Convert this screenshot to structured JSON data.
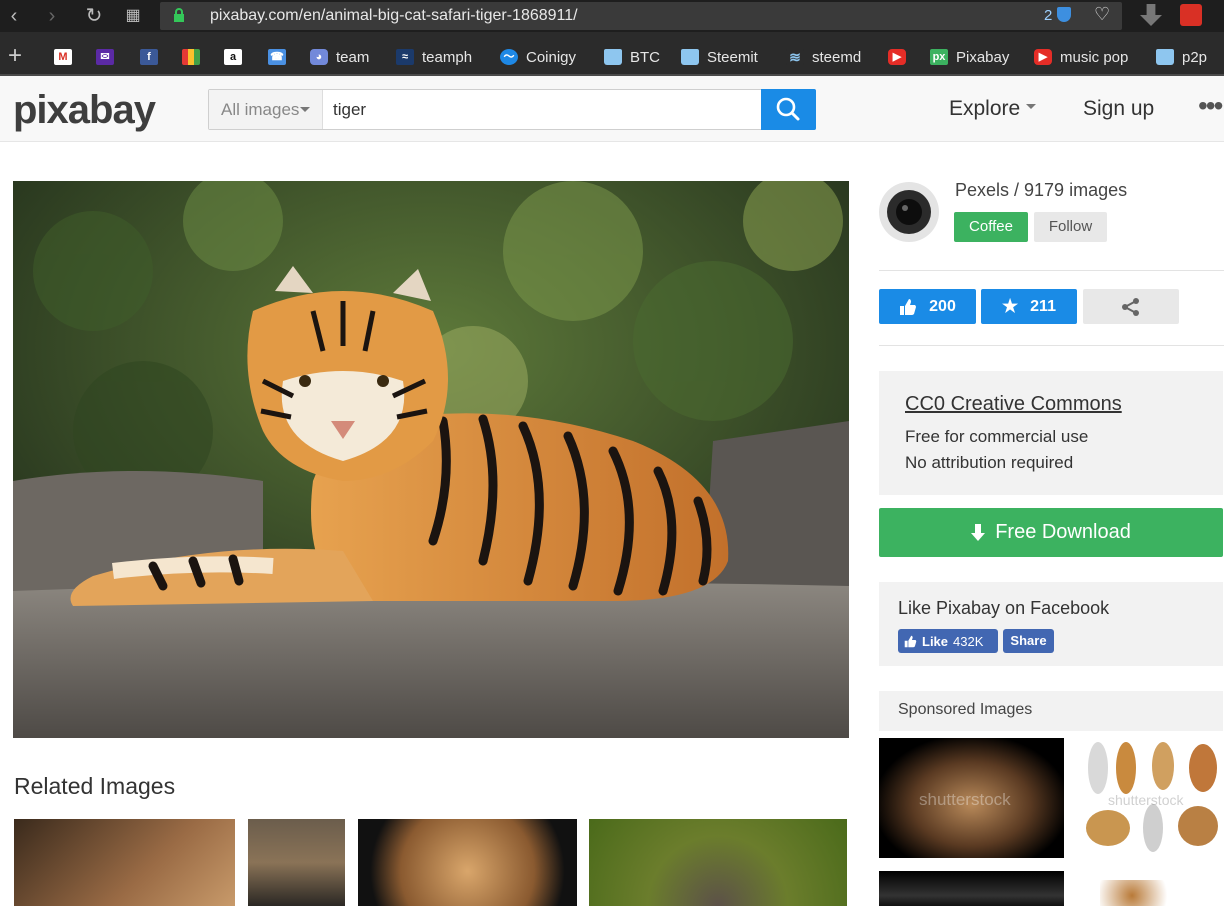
{
  "browser": {
    "url": "pixabay.com/en/animal-big-cat-safari-tiger-1868911/",
    "badge_count": "2",
    "bookmarks": [
      {
        "label": "",
        "icon": "gmail-icon"
      },
      {
        "label": "",
        "icon": "yahoo-mail-icon"
      },
      {
        "label": "",
        "icon": "facebook-icon"
      },
      {
        "label": "",
        "icon": "shopping-icon"
      },
      {
        "label": "",
        "icon": "amazon-icon"
      },
      {
        "label": "",
        "icon": "phone-icon"
      },
      {
        "label": "team",
        "icon": "discord-icon"
      },
      {
        "label": "teamph",
        "icon": "steemph-icon"
      },
      {
        "label": "Coinigy",
        "icon": "coinigy-icon"
      },
      {
        "label": "BTC",
        "icon": "folder-icon"
      },
      {
        "label": "Steemit",
        "icon": "folder-icon"
      },
      {
        "label": "steemd",
        "icon": "steem-icon"
      },
      {
        "label": "",
        "icon": "youtube-icon"
      },
      {
        "label": "Pixabay",
        "icon": "pixabay-icon"
      },
      {
        "label": "music pop",
        "icon": "youtube-icon"
      },
      {
        "label": "p2p",
        "icon": "folder-icon"
      }
    ]
  },
  "header": {
    "logo": "pixabay",
    "search_type": "All images",
    "search_value": "tiger",
    "explore_label": "Explore",
    "signup_label": "Sign up",
    "more_label": "•••"
  },
  "main": {
    "related_title": "Related Images"
  },
  "sidebar": {
    "user_line": "Pexels / 9179 images",
    "coffee_label": "Coffee",
    "follow_label": "Follow",
    "likes": "200",
    "favorites": "211",
    "license_title": "CC0 Creative Commons",
    "license_line1": "Free for commercial use",
    "license_line2": "No attribution required",
    "download_label": "Free Download",
    "fb_title": "Like Pixabay on Facebook",
    "fb_like_label": "Like",
    "fb_like_count": "432K",
    "fb_share_label": "Share",
    "sponsored_title": "Sponsored Images",
    "watermark": "shutterstock"
  },
  "colors": {
    "accent_blue": "#1a8be6",
    "green": "#3cb260",
    "facebook": "#4267b2"
  }
}
